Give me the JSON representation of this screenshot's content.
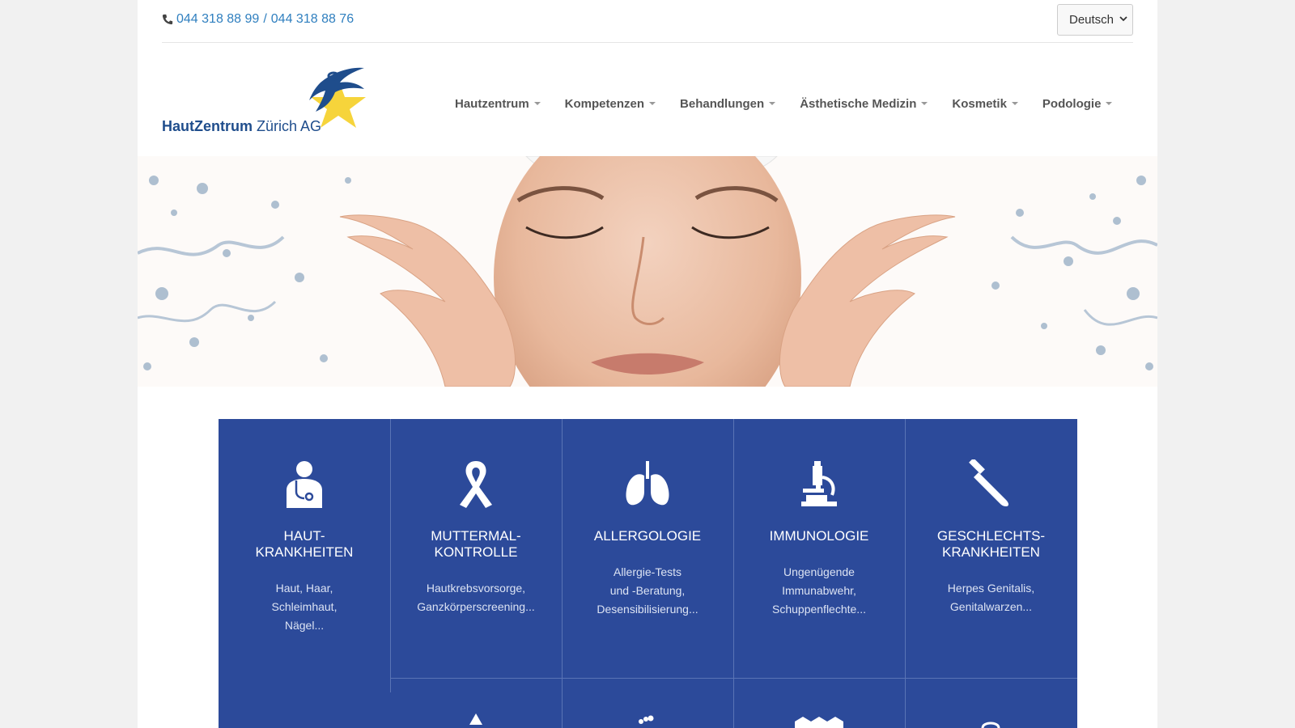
{
  "topbar": {
    "phone1": "044 318 88 99",
    "separator": "/",
    "phone2": "044 318 88 76",
    "phone_icon": "phone-icon",
    "language": "Deutsch"
  },
  "header": {
    "logo_bold": "HautZentrum",
    "logo_regular": "Zürich AG"
  },
  "nav": [
    {
      "label": "Hautzentrum"
    },
    {
      "label": "Kompetenzen"
    },
    {
      "label": "Behandlungen"
    },
    {
      "label": "Ästhetische Medizin"
    },
    {
      "label": "Kosmetik"
    },
    {
      "label": "Podologie"
    }
  ],
  "tiles": [
    {
      "title": "HAUT-\nKRANKHEITEN",
      "desc": "Haut, Haar,\nSchleimhaut,\nNägel...",
      "icon": "doctor-icon"
    },
    {
      "title": "MUTTERMAL-\nKONTROLLE",
      "desc": "Hautkrebsvorsorge,\nGanzkörperscreening...",
      "icon": "ribbon-icon"
    },
    {
      "title": "ALLERGOLOGIE",
      "desc": "Allergie-Tests\nund -Beratung,\nDesensibilisierung...",
      "icon": "lungs-icon"
    },
    {
      "title": "IMMUNOLOGIE",
      "desc": "Ungenügende\nImmunabwehr,\nSchuppenflechte...",
      "icon": "microscope-icon"
    },
    {
      "title": "GESCHLECHTS-\nKRANKHEITEN",
      "desc": "Herpes Genitalis,\nGenitalwarzen...",
      "icon": "test-tube-icon"
    }
  ],
  "colors": {
    "tile_bg": "#2c4a9a",
    "link": "#2f7fbf",
    "logo_blue": "#1f4d8c",
    "logo_yellow": "#f6d230"
  }
}
